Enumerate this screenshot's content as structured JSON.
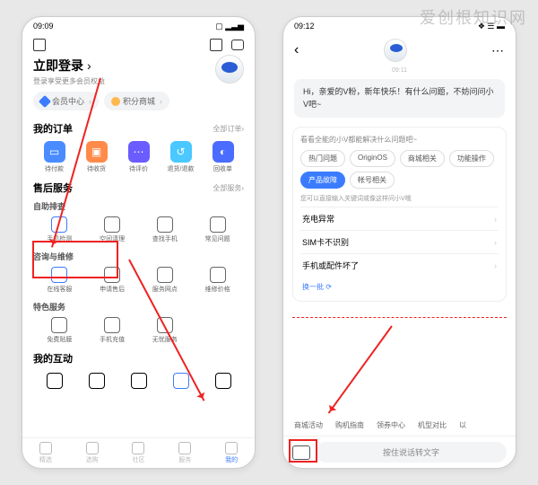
{
  "watermark": "爱创根知识网",
  "left": {
    "status": {
      "time": "09:09",
      "icons": "◐ ▿ ◉ ◎",
      "right": "▢ ▂▃▅"
    },
    "login": {
      "title": "立即登录",
      "sub": "登录享受更多会员权益"
    },
    "chips": [
      "会员中心",
      "积分商城"
    ],
    "orders": {
      "title": "我的订单",
      "more": "全部订单",
      "items": [
        "待付款",
        "待收货",
        "待评价",
        "退货/退款",
        "回收单"
      ]
    },
    "after": {
      "title": "售后服务",
      "more": "全部服务",
      "g1": {
        "title": "自助排查",
        "items": [
          "手机检测",
          "空间清理",
          "查找手机",
          "常见问题"
        ]
      },
      "g2": {
        "title": "咨询与维修",
        "items": [
          "在线客服",
          "申请售后",
          "服务网点",
          "维修价格"
        ]
      },
      "g3": {
        "title": "特色服务",
        "items": [
          "免费贴膜",
          "手机充值",
          "无忧服务"
        ]
      }
    },
    "inter": {
      "title": "我的互动"
    },
    "nav": [
      "精选",
      "选购",
      "社区",
      "服务",
      "我的"
    ]
  },
  "right": {
    "status": {
      "time": "09:12",
      "icons": "◑ ▣ ◉ ◎",
      "right": "❖ ☰ ▬"
    },
    "ts": "09:11",
    "bubble": "Hi，亲爱的V粉，新年快乐！有什么问题，不妨问问小V吧~",
    "faq": {
      "title": "看看全能的小V都能解决什么问题吧~",
      "tags": [
        "热门问题",
        "OriginOS",
        "商城相关",
        "功能操作",
        "产品故障",
        "帐号相关"
      ],
      "sub": "您可以直接输入关键词或像这样问小V哦",
      "qs": [
        "充电异常",
        "SIM卡不识别",
        "手机或配件坏了"
      ],
      "refresh": "换一批"
    },
    "quick": [
      "商城活动",
      "购机指南",
      "领券中心",
      "机型对比",
      "以"
    ],
    "voice": "按住说话转文字"
  }
}
